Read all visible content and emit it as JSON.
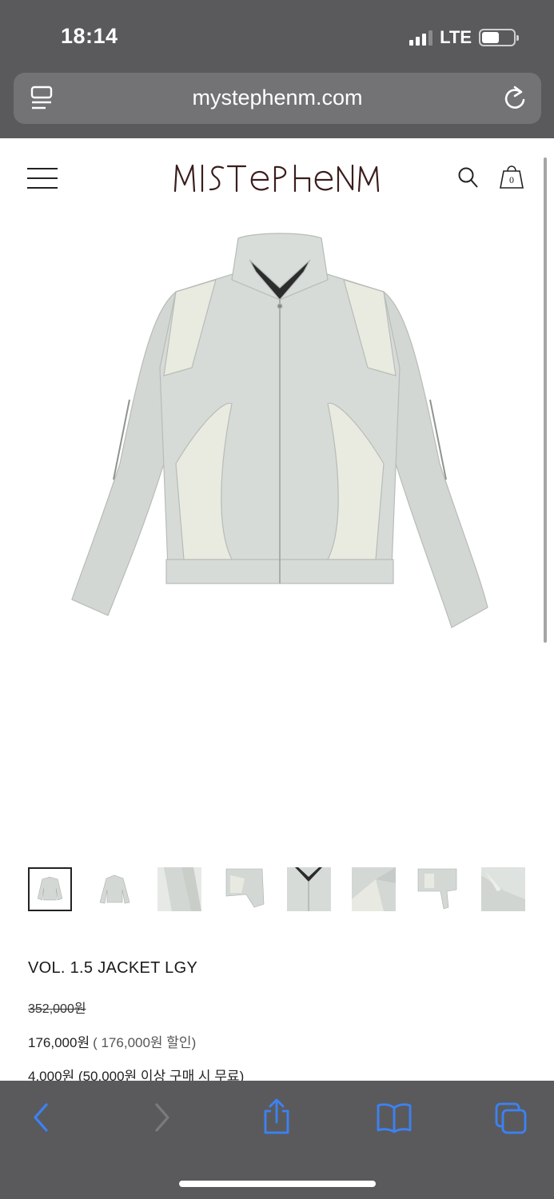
{
  "status_bar": {
    "time": "18:14",
    "network": "LTE"
  },
  "browser": {
    "url": "mystephenm.com"
  },
  "site": {
    "logo_text": "MYSTEPHENM",
    "cart_count": "0"
  },
  "product": {
    "name": "VOL. 1.5 JACKET LGY",
    "original_price": "352,000원",
    "sale_price": "176,000원",
    "discount_text": "( 176,000원 할인)",
    "shipping_text": "4,000원 (50,000원 이상 구매 시 무료)",
    "thumbnail_count": 8
  },
  "colors": {
    "chrome_gray": "#5a5a5c",
    "accent_blue": "#3b82f6",
    "jacket_color": "#d4d9d6"
  }
}
